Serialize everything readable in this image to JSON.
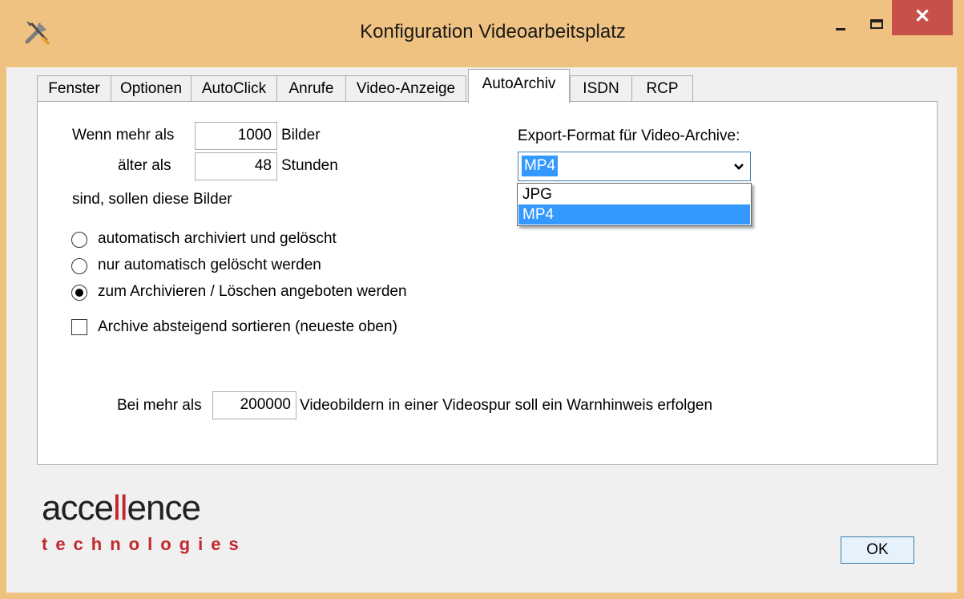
{
  "window": {
    "title": "Konfiguration Videoarbeitsplatz",
    "close_glyph": "✕",
    "icons": [
      "tools-icon",
      "minimize-icon",
      "maximize-icon",
      "close-icon"
    ]
  },
  "tabs": [
    {
      "label": "Fenster"
    },
    {
      "label": "Optionen"
    },
    {
      "label": "AutoClick"
    },
    {
      "label": "Anrufe"
    },
    {
      "label": "Video-Anzeige"
    },
    {
      "label": "AutoArchiv",
      "active": true
    },
    {
      "label": "ISDN"
    },
    {
      "label": "RCP"
    }
  ],
  "autoarchiv": {
    "more_than_label": "Wenn mehr als",
    "images_value": "1000",
    "images_unit": "Bilder",
    "older_than_label": "älter als",
    "hours_value": "48",
    "hours_unit": "Stunden",
    "then_label": "sind, sollen diese Bilder",
    "options": [
      {
        "label": "automatisch archiviert und gelöscht",
        "checked": false
      },
      {
        "label": "nur automatisch gelöscht werden",
        "checked": false
      },
      {
        "label": "zum Archivieren / Löschen angeboten werden",
        "checked": true
      }
    ],
    "sort_checkbox_label": "Archive absteigend sortieren (neueste oben)",
    "sort_checked": false,
    "warn_prefix": "Bei mehr als",
    "warn_value": "200000",
    "warn_suffix": "Videobildern in einer Videospur soll ein Warnhinweis erfolgen",
    "export_label": "Export-Format für Video-Archive:",
    "export_selected": "MP4",
    "export_arrow": "⌄",
    "export_options": [
      "JPG",
      "MP4"
    ]
  },
  "logo": {
    "main_prefix": "acce",
    "main_mid": "ll",
    "main_suffix": "ence",
    "sub": "technologies"
  },
  "buttons": {
    "ok_label": "OK"
  },
  "colors": {
    "titlebar": "#f0c282",
    "close": "#c7504a",
    "selection": "#3399ff",
    "logo_red": "#c1272d"
  }
}
